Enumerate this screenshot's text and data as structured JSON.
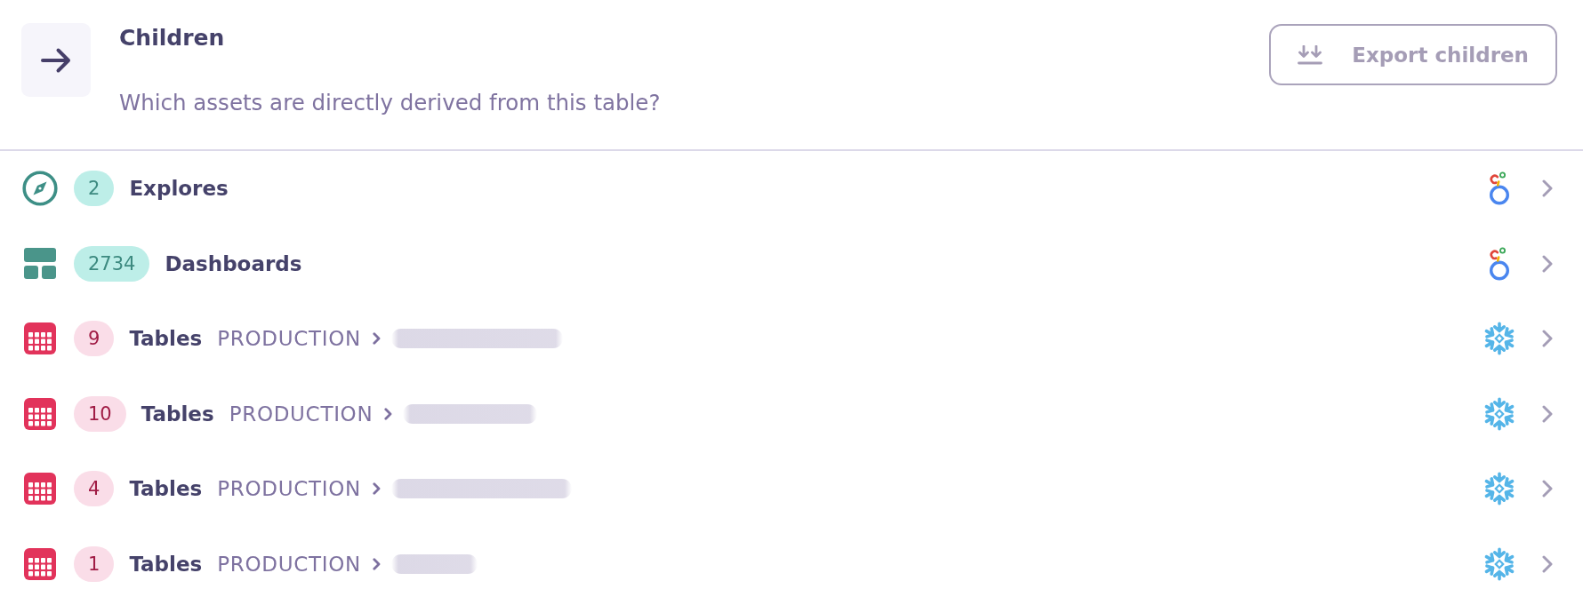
{
  "header": {
    "title": "Children",
    "subtitle": "Which assets are directly derived from this table?",
    "export_button": {
      "label": "Export children",
      "disabled": true
    }
  },
  "rows": [
    {
      "kind": "explore",
      "count": "2",
      "label": "Explores"
    },
    {
      "kind": "dashboard",
      "count": "2734",
      "label": "Dashboards"
    },
    {
      "kind": "table",
      "count": "9",
      "label": "Tables",
      "schema": "PRODUCTION",
      "name_blurred": true
    },
    {
      "kind": "table",
      "count": "10",
      "label": "Tables",
      "schema": "PRODUCTION",
      "name_blurred": true
    },
    {
      "kind": "table",
      "count": "4",
      "label": "Tables",
      "schema": "PRODUCTION",
      "name_blurred": true
    },
    {
      "kind": "table",
      "count": "1",
      "label": "Tables",
      "schema": "PRODUCTION",
      "name_blurred": true
    }
  ]
}
